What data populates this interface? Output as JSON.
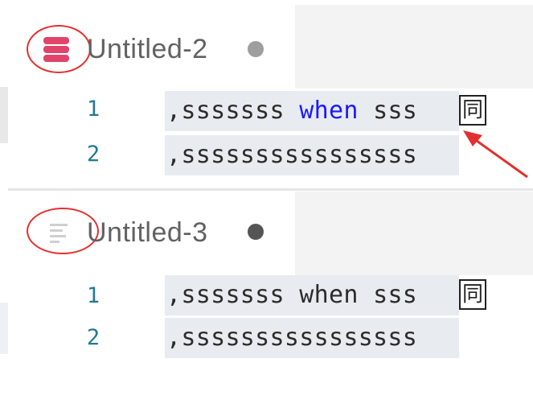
{
  "editor1": {
    "tab_title": "Untitled-2",
    "icon": "database-icon",
    "lines": [
      {
        "number": "1",
        "prefix": ",sssssss ",
        "keyword": "when",
        "suffix": " sss",
        "trailing_glyph": "同"
      },
      {
        "number": "2",
        "prefix": ",ssssssssssssssss",
        "keyword": "",
        "suffix": "",
        "trailing_glyph": ""
      }
    ],
    "keyword_color": "#1a1aff",
    "dot_color": "#9e9e9e"
  },
  "editor2": {
    "tab_title": "Untitled-3",
    "icon": "text-file-icon",
    "lines": [
      {
        "number": "1",
        "prefix": ",sssssss ",
        "keyword": "when",
        "suffix": " sss",
        "trailing_glyph": "同"
      },
      {
        "number": "2",
        "prefix": ",ssssssssssssssss",
        "keyword": "",
        "suffix": "",
        "trailing_glyph": ""
      }
    ],
    "keyword_color": "#2b2b2b",
    "dot_color": "#555555"
  },
  "annotation": {
    "color": "#e3302f",
    "arrow_icon": "red-arrow-icon"
  }
}
